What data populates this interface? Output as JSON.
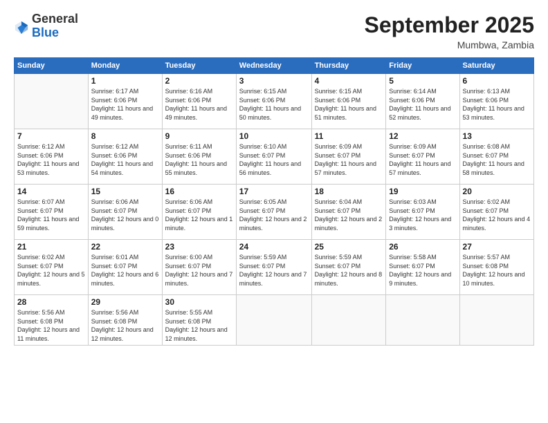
{
  "header": {
    "logo_general": "General",
    "logo_blue": "Blue",
    "month": "September 2025",
    "location": "Mumbwa, Zambia"
  },
  "weekdays": [
    "Sunday",
    "Monday",
    "Tuesday",
    "Wednesday",
    "Thursday",
    "Friday",
    "Saturday"
  ],
  "weeks": [
    [
      {
        "day": "",
        "info": ""
      },
      {
        "day": "1",
        "info": "Sunrise: 6:17 AM\nSunset: 6:06 PM\nDaylight: 11 hours\nand 49 minutes."
      },
      {
        "day": "2",
        "info": "Sunrise: 6:16 AM\nSunset: 6:06 PM\nDaylight: 11 hours\nand 49 minutes."
      },
      {
        "day": "3",
        "info": "Sunrise: 6:15 AM\nSunset: 6:06 PM\nDaylight: 11 hours\nand 50 minutes."
      },
      {
        "day": "4",
        "info": "Sunrise: 6:15 AM\nSunset: 6:06 PM\nDaylight: 11 hours\nand 51 minutes."
      },
      {
        "day": "5",
        "info": "Sunrise: 6:14 AM\nSunset: 6:06 PM\nDaylight: 11 hours\nand 52 minutes."
      },
      {
        "day": "6",
        "info": "Sunrise: 6:13 AM\nSunset: 6:06 PM\nDaylight: 11 hours\nand 53 minutes."
      }
    ],
    [
      {
        "day": "7",
        "info": "Sunrise: 6:12 AM\nSunset: 6:06 PM\nDaylight: 11 hours\nand 53 minutes."
      },
      {
        "day": "8",
        "info": "Sunrise: 6:12 AM\nSunset: 6:06 PM\nDaylight: 11 hours\nand 54 minutes."
      },
      {
        "day": "9",
        "info": "Sunrise: 6:11 AM\nSunset: 6:06 PM\nDaylight: 11 hours\nand 55 minutes."
      },
      {
        "day": "10",
        "info": "Sunrise: 6:10 AM\nSunset: 6:07 PM\nDaylight: 11 hours\nand 56 minutes."
      },
      {
        "day": "11",
        "info": "Sunrise: 6:09 AM\nSunset: 6:07 PM\nDaylight: 11 hours\nand 57 minutes."
      },
      {
        "day": "12",
        "info": "Sunrise: 6:09 AM\nSunset: 6:07 PM\nDaylight: 11 hours\nand 57 minutes."
      },
      {
        "day": "13",
        "info": "Sunrise: 6:08 AM\nSunset: 6:07 PM\nDaylight: 11 hours\nand 58 minutes."
      }
    ],
    [
      {
        "day": "14",
        "info": "Sunrise: 6:07 AM\nSunset: 6:07 PM\nDaylight: 11 hours\nand 59 minutes."
      },
      {
        "day": "15",
        "info": "Sunrise: 6:06 AM\nSunset: 6:07 PM\nDaylight: 12 hours\nand 0 minutes."
      },
      {
        "day": "16",
        "info": "Sunrise: 6:06 AM\nSunset: 6:07 PM\nDaylight: 12 hours\nand 1 minute."
      },
      {
        "day": "17",
        "info": "Sunrise: 6:05 AM\nSunset: 6:07 PM\nDaylight: 12 hours\nand 2 minutes."
      },
      {
        "day": "18",
        "info": "Sunrise: 6:04 AM\nSunset: 6:07 PM\nDaylight: 12 hours\nand 2 minutes."
      },
      {
        "day": "19",
        "info": "Sunrise: 6:03 AM\nSunset: 6:07 PM\nDaylight: 12 hours\nand 3 minutes."
      },
      {
        "day": "20",
        "info": "Sunrise: 6:02 AM\nSunset: 6:07 PM\nDaylight: 12 hours\nand 4 minutes."
      }
    ],
    [
      {
        "day": "21",
        "info": "Sunrise: 6:02 AM\nSunset: 6:07 PM\nDaylight: 12 hours\nand 5 minutes."
      },
      {
        "day": "22",
        "info": "Sunrise: 6:01 AM\nSunset: 6:07 PM\nDaylight: 12 hours\nand 6 minutes."
      },
      {
        "day": "23",
        "info": "Sunrise: 6:00 AM\nSunset: 6:07 PM\nDaylight: 12 hours\nand 7 minutes."
      },
      {
        "day": "24",
        "info": "Sunrise: 5:59 AM\nSunset: 6:07 PM\nDaylight: 12 hours\nand 7 minutes."
      },
      {
        "day": "25",
        "info": "Sunrise: 5:59 AM\nSunset: 6:07 PM\nDaylight: 12 hours\nand 8 minutes."
      },
      {
        "day": "26",
        "info": "Sunrise: 5:58 AM\nSunset: 6:07 PM\nDaylight: 12 hours\nand 9 minutes."
      },
      {
        "day": "27",
        "info": "Sunrise: 5:57 AM\nSunset: 6:08 PM\nDaylight: 12 hours\nand 10 minutes."
      }
    ],
    [
      {
        "day": "28",
        "info": "Sunrise: 5:56 AM\nSunset: 6:08 PM\nDaylight: 12 hours\nand 11 minutes."
      },
      {
        "day": "29",
        "info": "Sunrise: 5:56 AM\nSunset: 6:08 PM\nDaylight: 12 hours\nand 12 minutes."
      },
      {
        "day": "30",
        "info": "Sunrise: 5:55 AM\nSunset: 6:08 PM\nDaylight: 12 hours\nand 12 minutes."
      },
      {
        "day": "",
        "info": ""
      },
      {
        "day": "",
        "info": ""
      },
      {
        "day": "",
        "info": ""
      },
      {
        "day": "",
        "info": ""
      }
    ]
  ]
}
